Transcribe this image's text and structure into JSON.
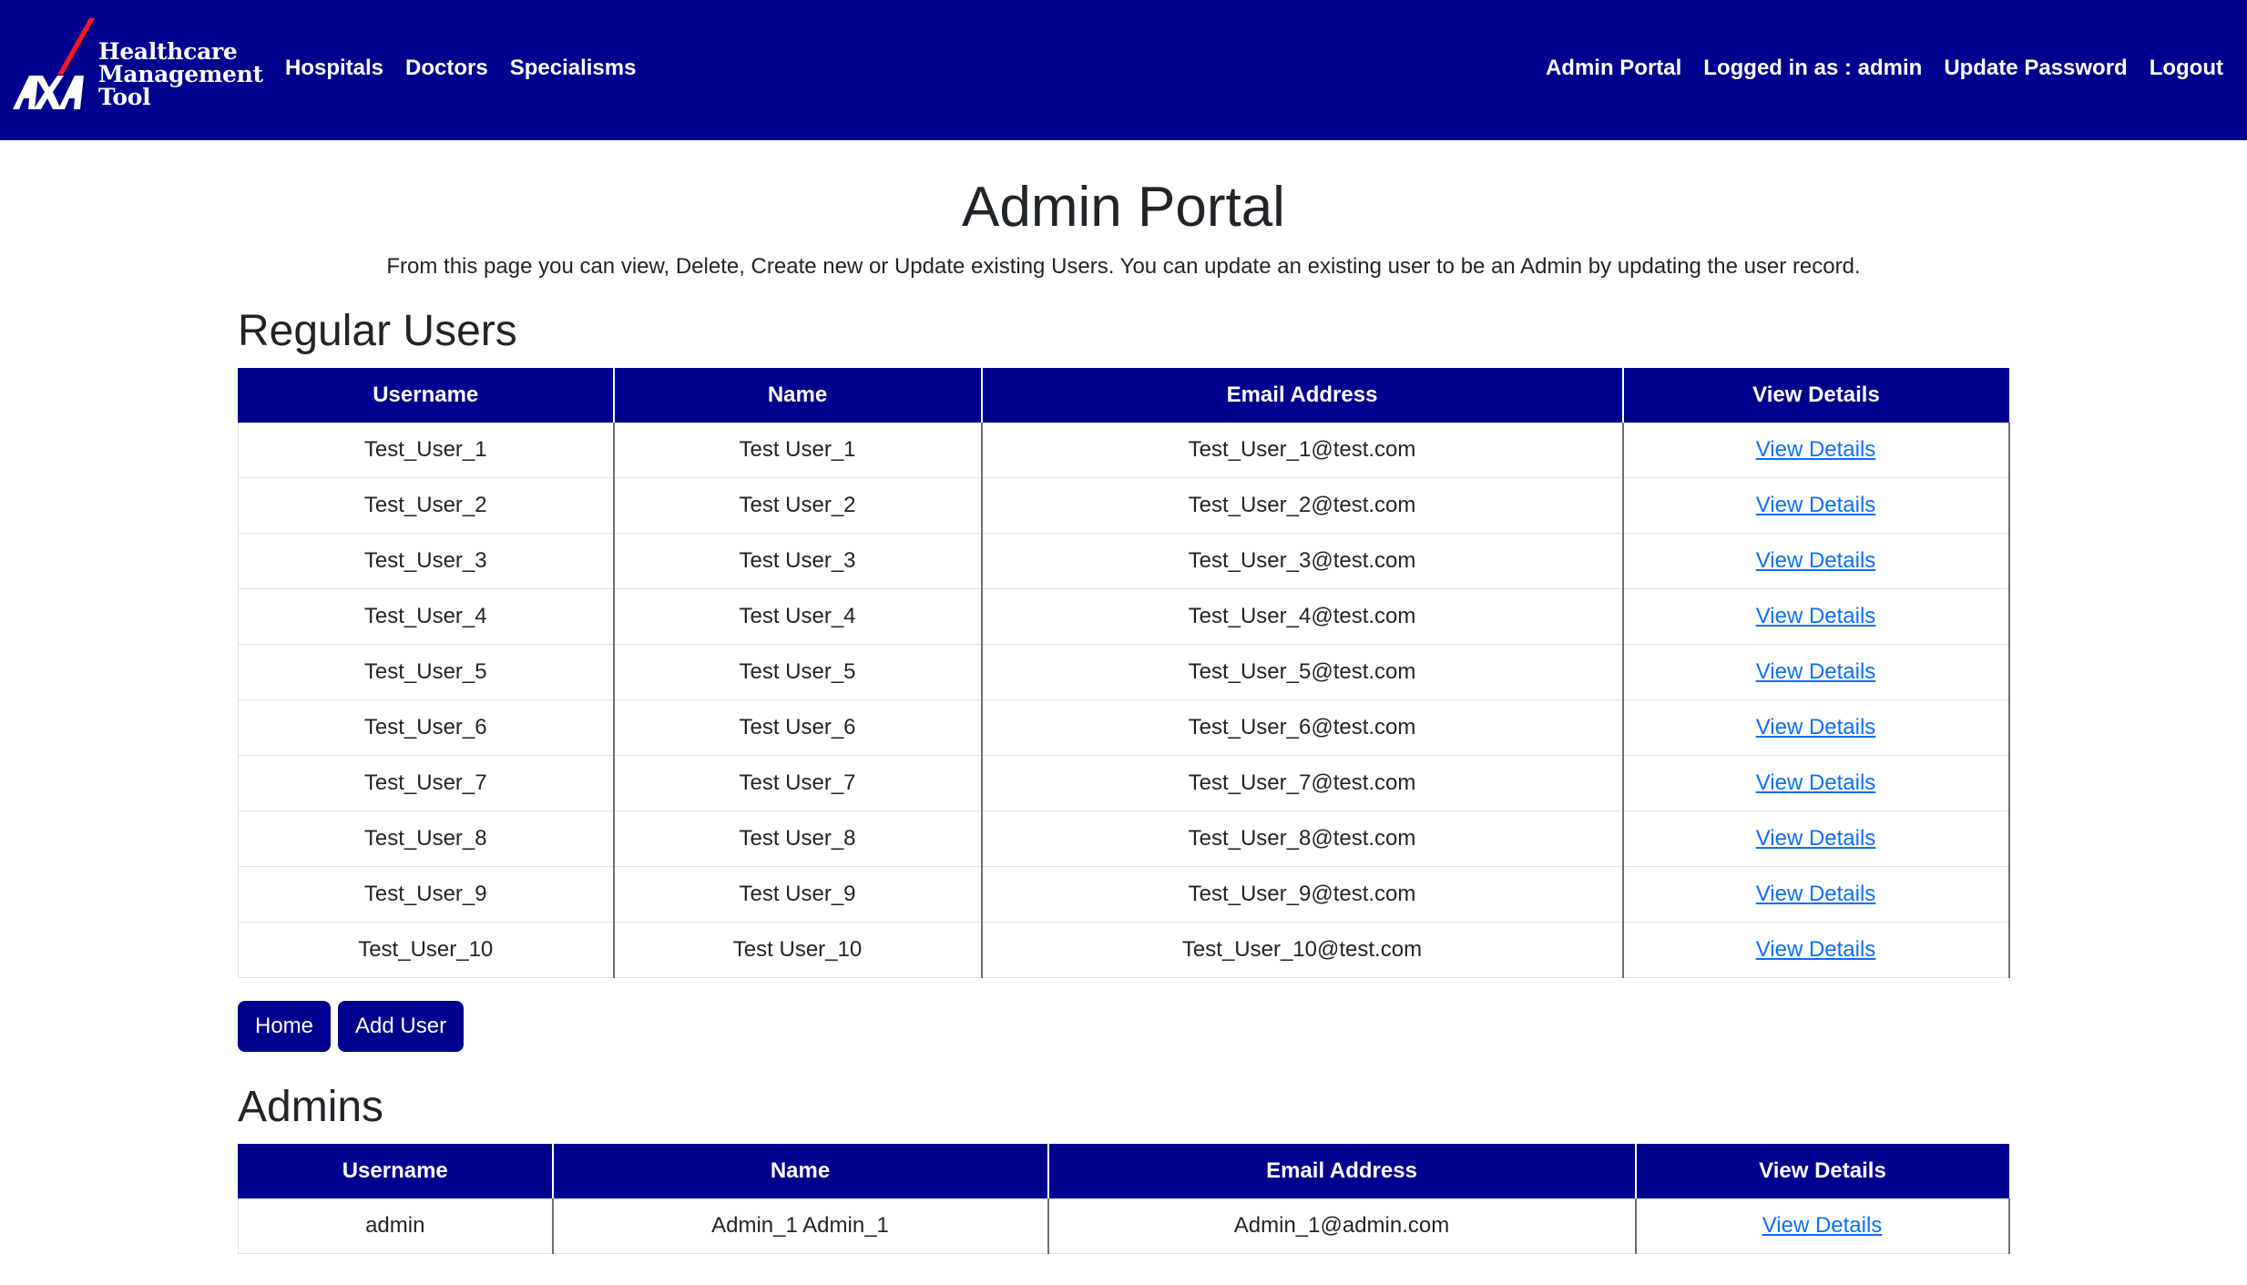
{
  "brand": {
    "logo_text": "AXA",
    "line1": "Healthcare",
    "line2": "Management",
    "line3": "Tool"
  },
  "nav": {
    "left": [
      "Hospitals",
      "Doctors",
      "Specialisms"
    ],
    "right": [
      "Admin Portal",
      "Logged in as : admin",
      "Update Password",
      "Logout"
    ]
  },
  "page": {
    "title": "Admin Portal",
    "description": "From this page you can view, Delete, Create new or Update existing Users. You can update an existing user to be an Admin by updating the user record."
  },
  "regular_users": {
    "heading": "Regular Users",
    "columns": [
      "Username",
      "Name",
      "Email Address",
      "View Details"
    ],
    "rows": [
      [
        "Test_User_1",
        "Test User_1",
        "Test_User_1@test.com",
        "View Details"
      ],
      [
        "Test_User_2",
        "Test User_2",
        "Test_User_2@test.com",
        "View Details"
      ],
      [
        "Test_User_3",
        "Test User_3",
        "Test_User_3@test.com",
        "View Details"
      ],
      [
        "Test_User_4",
        "Test User_4",
        "Test_User_4@test.com",
        "View Details"
      ],
      [
        "Test_User_5",
        "Test User_5",
        "Test_User_5@test.com",
        "View Details"
      ],
      [
        "Test_User_6",
        "Test User_6",
        "Test_User_6@test.com",
        "View Details"
      ],
      [
        "Test_User_7",
        "Test User_7",
        "Test_User_7@test.com",
        "View Details"
      ],
      [
        "Test_User_8",
        "Test User_8",
        "Test_User_8@test.com",
        "View Details"
      ],
      [
        "Test_User_9",
        "Test User_9",
        "Test_User_9@test.com",
        "View Details"
      ],
      [
        "Test_User_10",
        "Test User_10",
        "Test_User_10@test.com",
        "View Details"
      ]
    ]
  },
  "buttons": {
    "home": "Home",
    "add_user": "Add User"
  },
  "admins": {
    "heading": "Admins",
    "columns": [
      "Username",
      "Name",
      "Email Address",
      "View Details"
    ],
    "rows": [
      [
        "admin",
        "Admin_1 Admin_1",
        "Admin_1@admin.com",
        "View Details"
      ]
    ]
  },
  "colors": {
    "primary": "#00008f",
    "link": "#0d6efd",
    "logo_slash": "#ff1721"
  }
}
